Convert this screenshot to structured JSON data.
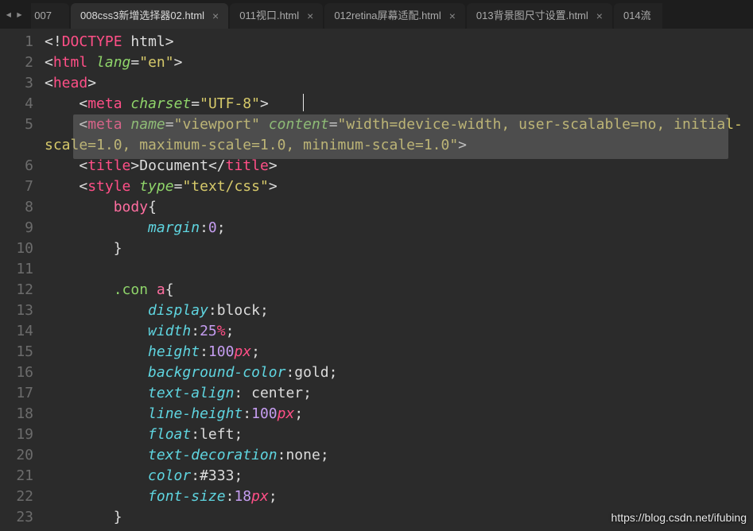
{
  "nav": {
    "back": "◂",
    "forward": "▸"
  },
  "tabs": [
    {
      "label": "007",
      "close": "",
      "cls": "dim partial-left"
    },
    {
      "label": "008css3新增选择器02.html",
      "close": "×",
      "cls": ""
    },
    {
      "label": "011视口.html",
      "close": "×",
      "cls": "dim"
    },
    {
      "label": "012retina屏幕适配.html",
      "close": "×",
      "cls": "dim"
    },
    {
      "label": "013背景图尺寸设置.html",
      "close": "×",
      "cls": "dim"
    },
    {
      "label": "014流",
      "close": "",
      "cls": "dim partial-right"
    }
  ],
  "gutter": [
    "1",
    "2",
    "3",
    "4",
    "5",
    "6",
    "7",
    "8",
    "9",
    "10",
    "11",
    "12",
    "13",
    "14",
    "15",
    "16",
    "17",
    "18",
    "19",
    "20",
    "21",
    "22",
    "23"
  ],
  "code": {
    "l1": {
      "open": "<",
      "bang": "!",
      "doctype": "DOCTYPE",
      "sp": " ",
      "html": "html",
      "close": ">"
    },
    "l2": {
      "open": "<",
      "tag": "html",
      "sp": " ",
      "attr": "lang",
      "eq": "=",
      "str": "\"en\"",
      "close": ">"
    },
    "l3": {
      "open": "<",
      "tag": "head",
      "close": ">"
    },
    "l4": {
      "pad": "    ",
      "open": "<",
      "tag": "meta",
      "sp": " ",
      "attr": "charset",
      "eq": "=",
      "str": "\"UTF-8\"",
      "close": ">"
    },
    "l5": {
      "pad": "    ",
      "open": "<",
      "tag": "meta",
      "sp": " ",
      "a1": "name",
      "eq1": "=",
      "s1": "\"viewport\"",
      "sp2": " ",
      "a2": "content",
      "eq2": "=",
      "s2": "\"width=device-width, user-scalable=no, initial-scale=1.0, maximum-scale=1.0, minimum-scale=1.0\"",
      "close": ">"
    },
    "l6": {
      "pad": "    ",
      "open": "<",
      "tag": "title",
      "close1": ">",
      "text": "Document",
      "open2": "</",
      "tag2": "title",
      "close2": ">"
    },
    "l7": {
      "pad": "    ",
      "open": "<",
      "tag": "style",
      "sp": " ",
      "attr": "type",
      "eq": "=",
      "str": "\"text/css\"",
      "close": ">"
    },
    "l8": {
      "pad": "        ",
      "sel": "body",
      "brace": "{"
    },
    "l9": {
      "pad": "            ",
      "prop": "margin",
      "colon": ":",
      "val": "0",
      "semi": ";"
    },
    "l10": {
      "pad": "        ",
      "brace": "}"
    },
    "l11": {
      "pad": ""
    },
    "l12": {
      "pad": "        ",
      "sel": ".con ",
      "sel2": "a",
      "brace": "{"
    },
    "l13": {
      "pad": "            ",
      "prop": "display",
      "colon": ":",
      "val": "block",
      "semi": ";"
    },
    "l14": {
      "pad": "            ",
      "prop": "width",
      "colon": ":",
      "num": "25",
      "unit": "%",
      "semi": ";"
    },
    "l15": {
      "pad": "            ",
      "prop": "height",
      "colon": ":",
      "num": "100",
      "unit": "px",
      "semi": ";"
    },
    "l16": {
      "pad": "            ",
      "prop": "background-color",
      "colon": ":",
      "val": "gold",
      "semi": ";"
    },
    "l17": {
      "pad": "            ",
      "prop": "text-align",
      "colon": ": ",
      "val": "center",
      "semi": ";"
    },
    "l18": {
      "pad": "            ",
      "prop": "line-height",
      "colon": ":",
      "num": "100",
      "unit": "px",
      "semi": ";"
    },
    "l19": {
      "pad": "            ",
      "prop": "float",
      "colon": ":",
      "val": "left",
      "semi": ";"
    },
    "l20": {
      "pad": "            ",
      "prop": "text-decoration",
      "colon": ":",
      "val": "none",
      "semi": ";"
    },
    "l21": {
      "pad": "            ",
      "prop": "color",
      "colon": ":",
      "val": "#333",
      "semi": ";"
    },
    "l22": {
      "pad": "            ",
      "prop": "font-size",
      "colon": ":",
      "num": "18",
      "unit": "px",
      "semi": ";"
    },
    "l23": {
      "pad": "        ",
      "brace": "}"
    }
  },
  "watermark": "https://blog.csdn.net/ifubing"
}
